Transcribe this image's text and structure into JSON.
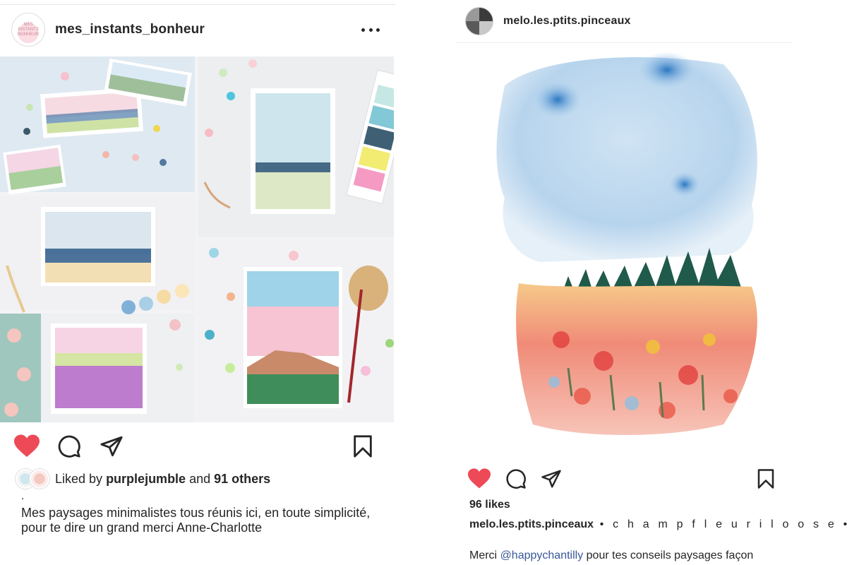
{
  "left_post": {
    "username": "mes_instants_bonheur",
    "avatar_text": "MES INSTANTS BONHEUR",
    "liked_prefix": "Liked by",
    "liked_user": "purplejumble",
    "liked_and": "and",
    "liked_others": "91 others",
    "dot": ".",
    "caption": "Mes paysages minimalistes tous réunis ici, en toute simplicité, pour te dire un grand merci Anne-Charlotte",
    "liked": true
  },
  "right_post": {
    "username": "melo.les.ptits.pinceaux",
    "likes": "96 likes",
    "caption_username": "melo.les.ptits.pinceaux",
    "caption_text": " • c h a m p f l e u r i l o o s e •",
    "caption2_prefix": "Merci ",
    "caption2_mention": "@happychantilly",
    "caption2_suffix": " pour tes conseils paysages façon",
    "liked": true
  },
  "colors": {
    "heart": "#ed4956",
    "text": "#262626",
    "mention": "#385898"
  },
  "icons": [
    "heart-icon",
    "comment-icon",
    "share-icon",
    "bookmark-icon",
    "more-icon"
  ]
}
